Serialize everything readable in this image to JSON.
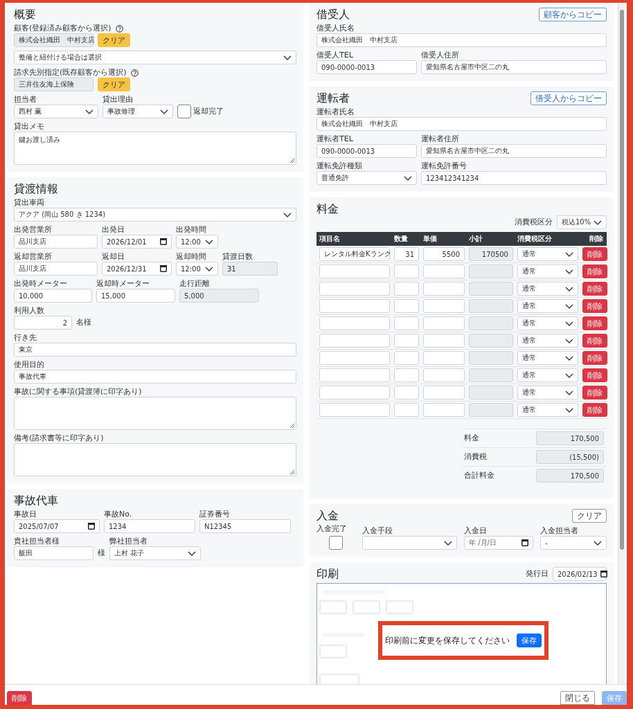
{
  "left_column": [
    {
      "kind": "form",
      "title": "概要",
      "rows": [
        [
          {
            "kind": "picked",
            "label": "顧客(登録済み顧客から選択)",
            "help": true,
            "value": "株式会社織田　中村支店",
            "button": "クリア"
          }
        ],
        [
          {
            "kind": "select",
            "value": "整備と紐付ける場合は選択"
          }
        ],
        [
          {
            "kind": "picked",
            "label": "請求先別指定(既存顧客から選択)",
            "help": true,
            "value": "三井住友海上保険",
            "button": "クリア"
          }
        ],
        [
          {
            "kind": "select",
            "label": "担当者",
            "value": "西村 薫"
          },
          {
            "kind": "select",
            "label": "貸出理由",
            "value": "事故修理"
          },
          {
            "kind": "checkbox",
            "label": "返却完了",
            "checked": false
          }
        ],
        [
          {
            "kind": "textarea",
            "label": "貸出メモ",
            "value": "鍵お渡し済み"
          }
        ]
      ]
    },
    {
      "kind": "form",
      "title": "貸渡情報",
      "rows": [
        [
          {
            "kind": "select",
            "label": "貸出車両",
            "value": "アクア (岡山 580 き 1234)"
          }
        ],
        [
          {
            "kind": "text",
            "label": "出発営業所",
            "value": "品川支店"
          },
          {
            "kind": "date",
            "label": "出発日",
            "value": "2026/12/01"
          },
          {
            "kind": "select",
            "label": "出発時間",
            "value": "12:00"
          }
        ],
        [
          {
            "kind": "text",
            "label": "返却営業所",
            "value": "品川支店"
          },
          {
            "kind": "date",
            "label": "返却日",
            "value": "2026/12/31"
          },
          {
            "kind": "select",
            "label": "返却時間",
            "value": "12:00"
          },
          {
            "kind": "readonly",
            "label": "貸渡日数",
            "value": "31"
          }
        ],
        [
          {
            "kind": "text",
            "label": "出発時メーター",
            "value": "10,000"
          },
          {
            "kind": "text",
            "label": "返却時メーター",
            "value": "15,000"
          },
          {
            "kind": "readonly",
            "label": "走行距離",
            "value": "5,000"
          }
        ],
        [
          {
            "kind": "number",
            "label": "利用人数",
            "value": "2",
            "suffix": "名様"
          }
        ],
        [
          {
            "kind": "text",
            "label": "行き先",
            "value": "東京"
          }
        ],
        [
          {
            "kind": "text",
            "label": "使用目的",
            "value": "事故代車"
          }
        ],
        [
          {
            "kind": "textarea",
            "label": "事故に関する事項(貸渡簿に印字あり)"
          }
        ],
        [
          {
            "kind": "textarea",
            "label": "備考(請求書等に印字あり)"
          }
        ]
      ]
    },
    {
      "kind": "form",
      "title": "事故代車",
      "rows": [
        [
          {
            "kind": "date",
            "label": "事故日",
            "value": "2025/07/07"
          },
          {
            "kind": "text",
            "label": "事故No.",
            "value": "1234"
          },
          {
            "kind": "text",
            "label": "証券番号",
            "value": "N12345"
          }
        ],
        [
          {
            "kind": "text",
            "label": "貴社担当者様",
            "value": "飯田",
            "suffix": "様"
          },
          {
            "kind": "select",
            "label": "弊社担当者",
            "value": "上村 花子"
          }
        ]
      ]
    }
  ],
  "right_column": [
    {
      "kind": "form",
      "title": "借受人",
      "action_button": "顧客からコピー",
      "rows": [
        [
          {
            "kind": "text",
            "label": "借受人氏名",
            "value": "株式会社織田　中村支店"
          }
        ],
        [
          {
            "kind": "text",
            "label": "借受人TEL",
            "value": "090-0000-0013"
          },
          {
            "kind": "text",
            "label": "借受人住所",
            "value": "愛知県名古屋市中区二の丸"
          }
        ]
      ]
    },
    {
      "kind": "form",
      "title": "運転者",
      "action_button": "借受人からコピー",
      "rows": [
        [
          {
            "kind": "text",
            "label": "運転者氏名",
            "value": "株式会社織田　中村支店"
          }
        ],
        [
          {
            "kind": "text",
            "label": "運転者TEL",
            "value": "090-0000-0013"
          },
          {
            "kind": "text",
            "label": "運転者住所",
            "value": "愛知県名古屋市中区二の丸"
          }
        ],
        [
          {
            "kind": "select",
            "label": "運転免許種類",
            "value": "普通免許"
          },
          {
            "kind": "text",
            "label": "運転免許番号",
            "value": "123412341234"
          }
        ]
      ]
    },
    {
      "kind": "fees",
      "title": "料金",
      "tax_mode": {
        "label": "消費税区分",
        "value": "税込10%"
      },
      "columns": [
        "項目名",
        "数量",
        "単価",
        "小計",
        "消費税区分",
        "削除"
      ],
      "rows": [
        {
          "name": "レンタル料金Kランク",
          "quantity": "31",
          "unit_price": "5500",
          "subtotal": "170500",
          "tax": "通常",
          "delete": "削除"
        },
        {
          "tax": "通常",
          "delete": "削除"
        },
        {
          "tax": "通常",
          "delete": "削除"
        },
        {
          "tax": "通常",
          "delete": "削除"
        },
        {
          "tax": "通常",
          "delete": "削除"
        },
        {
          "tax": "通常",
          "delete": "削除"
        },
        {
          "tax": "通常",
          "delete": "削除"
        },
        {
          "tax": "通常",
          "delete": "削除"
        },
        {
          "tax": "通常",
          "delete": "削除"
        },
        {
          "tax": "通常",
          "delete": "削除"
        }
      ],
      "totals": [
        {
          "label": "料金",
          "value": "170,500"
        },
        {
          "label": "消費税",
          "value": "(15,500)"
        },
        {
          "label": "合計料金",
          "value": "170,500"
        }
      ]
    },
    {
      "kind": "payment",
      "title": "入金",
      "clear_button": "クリア",
      "paid": {
        "label": "入金完了",
        "checked": false
      },
      "method": {
        "label": "入金手段"
      },
      "date": {
        "label": "入金日",
        "placeholder": "年 /月/日"
      },
      "staff": {
        "label": "入金担当者",
        "value": "-"
      }
    },
    {
      "kind": "print",
      "title": "印刷",
      "issue_date": {
        "label": "発行日",
        "value": "2026/02/13"
      },
      "notice": {
        "text": "印刷前に変更を保存してください",
        "button": "保存"
      }
    }
  ],
  "footer": {
    "delete": {
      "label": "削除"
    },
    "close": {
      "label": "閉じる"
    },
    "save": {
      "label": "保存",
      "disabled": true
    }
  }
}
